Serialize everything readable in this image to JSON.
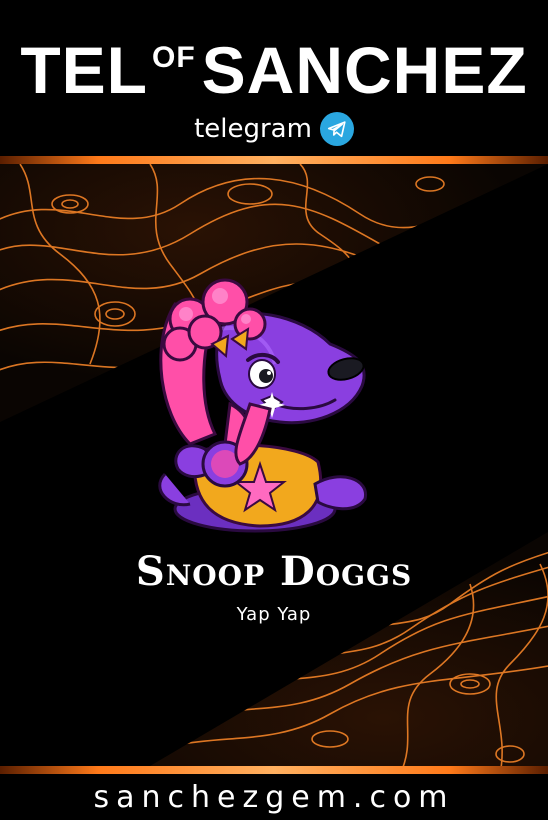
{
  "header": {
    "title_left": "TEL",
    "title_of": "OF",
    "title_right": "SANCHEZ",
    "telegram_label": "telegram"
  },
  "card": {
    "name": "Snoop Doggs",
    "tagline": "Yap Yap"
  },
  "footer": {
    "website": "sanchezgem.com"
  },
  "colors": {
    "background": "#000000",
    "accent_orange": "#ff7a1a",
    "telegram_blue": "#2aa7e0",
    "character_purple": "#8a3fe0",
    "character_pink": "#ff4fa8",
    "shirt_yellow": "#f2a81d"
  },
  "icons": [
    "telegram-icon",
    "snoop-doggs-character"
  ]
}
